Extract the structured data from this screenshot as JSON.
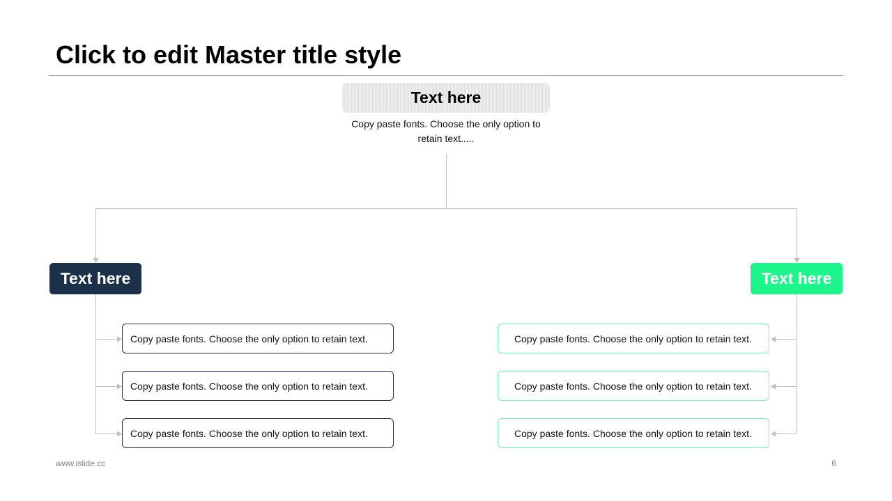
{
  "slide": {
    "title": "Click to edit Master title style",
    "footer_left": "www.islide.cc",
    "page_number": "6"
  },
  "top_node": {
    "label": "Text here",
    "description": "Copy paste fonts. Choose the only option to retain text....."
  },
  "left_branch": {
    "label": "Text here",
    "color": "#1b3049",
    "items": [
      "Copy paste fonts. Choose the only option to retain text.",
      "Copy paste fonts. Choose the only option to retain text.",
      "Copy paste fonts. Choose the only option to retain text."
    ]
  },
  "right_branch": {
    "label": "Text here",
    "color": "#1ef58b",
    "items": [
      "Copy paste fonts. Choose the only option to retain text.",
      "Copy paste fonts. Choose the only option to retain text.",
      "Copy paste fonts. Choose the only option to retain text."
    ]
  },
  "connector_color": "#bfbfbf"
}
